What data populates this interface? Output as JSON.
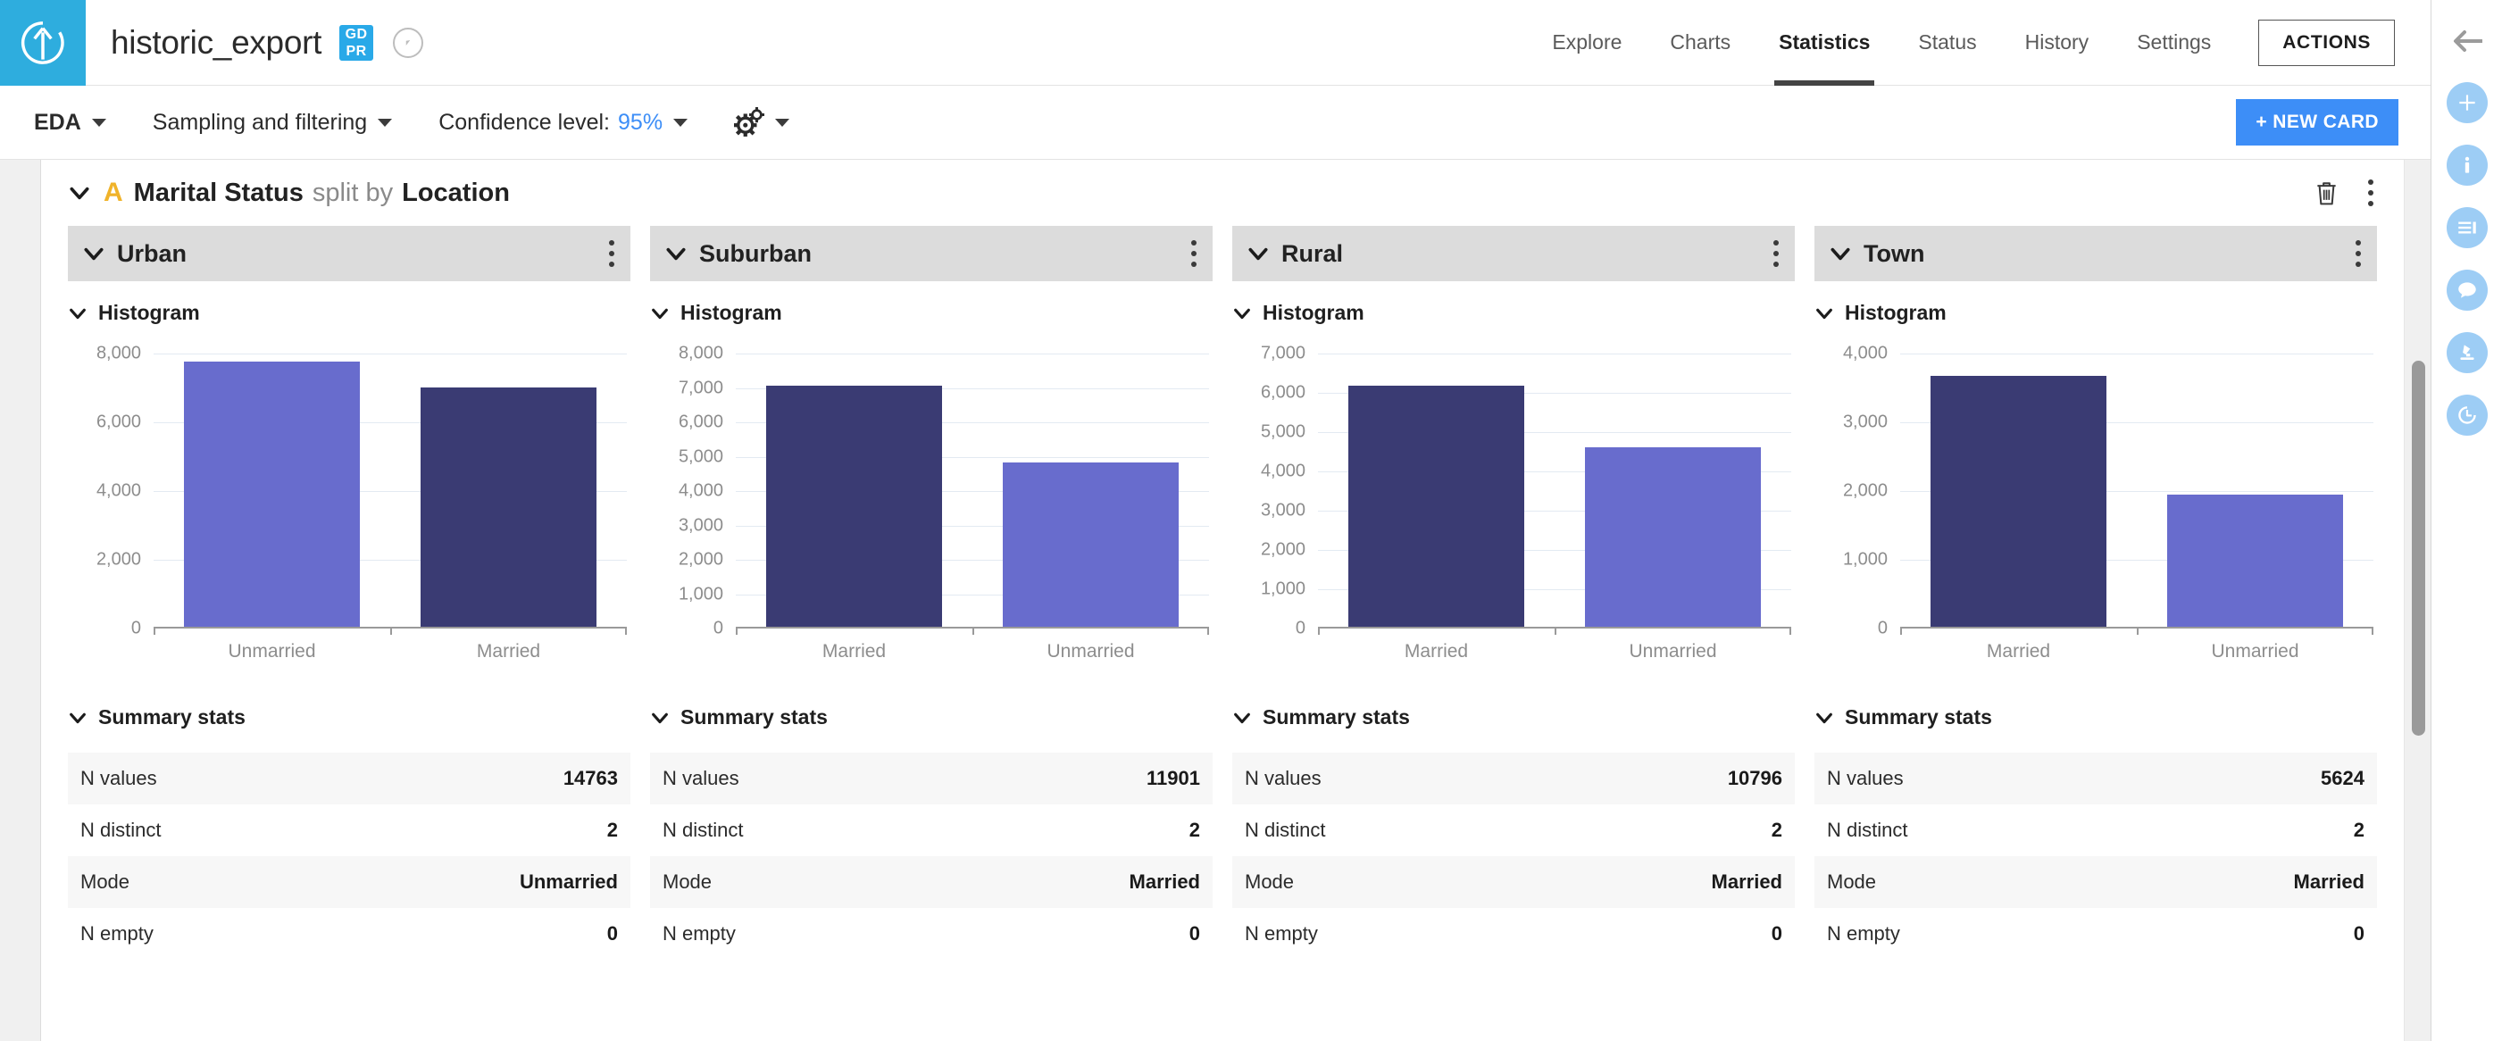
{
  "header": {
    "logo_icon": "up-arrow-circle-icon",
    "project_title": "historic_export",
    "gdpr_badge_line1": "GD",
    "gdpr_badge_line2": "PR",
    "compass_icon": "compass-icon",
    "nav": [
      {
        "label": "Explore",
        "active": false
      },
      {
        "label": "Charts",
        "active": false
      },
      {
        "label": "Statistics",
        "active": true
      },
      {
        "label": "Status",
        "active": false
      },
      {
        "label": "History",
        "active": false
      },
      {
        "label": "Settings",
        "active": false
      }
    ],
    "actions_label": "ACTIONS"
  },
  "toolbar": {
    "eda_label": "EDA",
    "sampling_label": "Sampling and filtering",
    "confidence_prefix": "Confidence level:",
    "confidence_value": "95%",
    "settings_icon": "gears-icon",
    "new_card_label": "+ NEW CARD"
  },
  "card": {
    "variable": "Marital Status",
    "split_by_text": "split by",
    "split_variable": "Location",
    "type_icon_letter": "A",
    "delete_icon": "trash-icon",
    "more_icon": "kebab-menu-icon",
    "histogram_label": "Histogram",
    "summary_label": "Summary stats",
    "stat_keys": [
      "N values",
      "N distinct",
      "Mode",
      "N empty"
    ]
  },
  "colors": {
    "bar_light": "#686ccd",
    "bar_dark": "#3a3b73",
    "accent_blue": "#3d8ef7",
    "brand_blue": "#2eadde",
    "type_orange": "#f0b32a",
    "panel_header": "#dcdcdc"
  },
  "columns": [
    {
      "name": "Urban",
      "stats": {
        "n_values": "14763",
        "n_distinct": "2",
        "mode": "Unmarried",
        "n_empty": "0"
      }
    },
    {
      "name": "Suburban",
      "stats": {
        "n_values": "11901",
        "n_distinct": "2",
        "mode": "Married",
        "n_empty": "0"
      }
    },
    {
      "name": "Rural",
      "stats": {
        "n_values": "10796",
        "n_distinct": "2",
        "mode": "Married",
        "n_empty": "0"
      }
    },
    {
      "name": "Town",
      "stats": {
        "n_values": "5624",
        "n_distinct": "2",
        "mode": "Married",
        "n_empty": "0"
      }
    }
  ],
  "chart_data": [
    {
      "type": "bar",
      "title": "Urban",
      "categories": [
        "Unmarried",
        "Married"
      ],
      "values": [
        7760,
        7003
      ],
      "colors": [
        "#686ccd",
        "#3a3b73"
      ],
      "ylim": [
        0,
        8000
      ],
      "yticks": [
        0,
        2000,
        4000,
        6000,
        8000
      ],
      "ytick_labels": [
        "0",
        "2,000",
        "4,000",
        "6,000",
        "8,000"
      ],
      "xlabel": "",
      "ylabel": "",
      "grid": true,
      "legend": "none"
    },
    {
      "type": "bar",
      "title": "Suburban",
      "categories": [
        "Married",
        "Unmarried"
      ],
      "values": [
        7070,
        4831
      ],
      "colors": [
        "#3a3b73",
        "#686ccd"
      ],
      "ylim": [
        0,
        8000
      ],
      "yticks": [
        0,
        1000,
        2000,
        3000,
        4000,
        5000,
        6000,
        7000,
        8000
      ],
      "ytick_labels": [
        "0",
        "1,000",
        "2,000",
        "3,000",
        "4,000",
        "5,000",
        "6,000",
        "7,000",
        "8,000"
      ],
      "xlabel": "",
      "ylabel": "",
      "grid": true,
      "legend": "none"
    },
    {
      "type": "bar",
      "title": "Rural",
      "categories": [
        "Married",
        "Unmarried"
      ],
      "values": [
        6190,
        4606
      ],
      "colors": [
        "#3a3b73",
        "#686ccd"
      ],
      "ylim": [
        0,
        7000
      ],
      "yticks": [
        0,
        1000,
        2000,
        3000,
        4000,
        5000,
        6000,
        7000
      ],
      "ytick_labels": [
        "0",
        "1,000",
        "2,000",
        "3,000",
        "4,000",
        "5,000",
        "6,000",
        "7,000"
      ],
      "xlabel": "",
      "ylabel": "",
      "grid": true,
      "legend": "none"
    },
    {
      "type": "bar",
      "title": "Town",
      "categories": [
        "Married",
        "Unmarried"
      ],
      "values": [
        3680,
        1944
      ],
      "colors": [
        "#3a3b73",
        "#686ccd"
      ],
      "ylim": [
        0,
        4000
      ],
      "yticks": [
        0,
        1000,
        2000,
        3000,
        4000
      ],
      "ytick_labels": [
        "0",
        "1,000",
        "2,000",
        "3,000",
        "4,000"
      ],
      "xlabel": "",
      "ylabel": "",
      "grid": true,
      "legend": "none"
    }
  ],
  "right_rail": {
    "back_icon": "back-arrow-icon",
    "items": [
      {
        "icon": "plus-icon"
      },
      {
        "icon": "info-icon"
      },
      {
        "icon": "details-list-icon"
      },
      {
        "icon": "chat-icon"
      },
      {
        "icon": "lab-microscope-icon"
      },
      {
        "icon": "history-clock-icon"
      }
    ]
  },
  "scrollbar": {
    "name": "vertical-scrollbar"
  }
}
